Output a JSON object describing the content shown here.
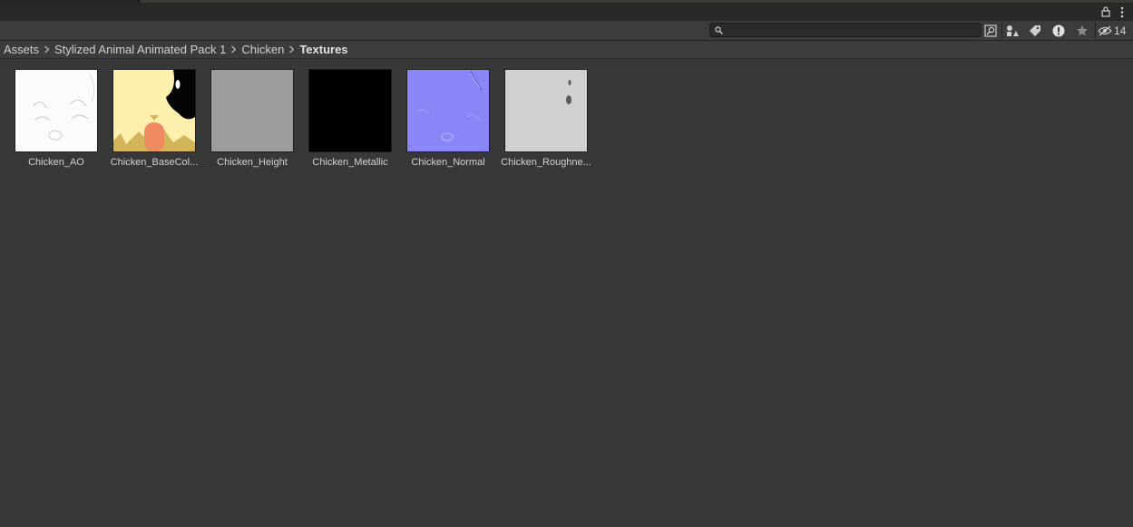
{
  "header": {
    "search": {
      "value": "",
      "placeholder": ""
    },
    "hidden_count": "14",
    "icons": [
      "lock-icon",
      "more-options-icon",
      "search-icon",
      "search-by-type-icon",
      "search-by-label-icon",
      "console-warning-icon",
      "favorite-star-icon",
      "hidden-packages-eye-icon"
    ]
  },
  "breadcrumb": {
    "items": [
      "Assets",
      "Stylized Animal Animated Pack 1",
      "Chicken",
      "Textures"
    ]
  },
  "assets": [
    {
      "name": "Chicken_AO"
    },
    {
      "name": "Chicken_BaseCol..."
    },
    {
      "name": "Chicken_Height"
    },
    {
      "name": "Chicken_Metallic"
    },
    {
      "name": "Chicken_Normal"
    },
    {
      "name": "Chicken_Roughne..."
    }
  ],
  "colors": {
    "background": "#383838",
    "toolbar": "#3c3c3c",
    "normal_map": "#8a86f8",
    "base_color_yellow": "#fff0b0",
    "base_color_orange": "#f08a60"
  }
}
